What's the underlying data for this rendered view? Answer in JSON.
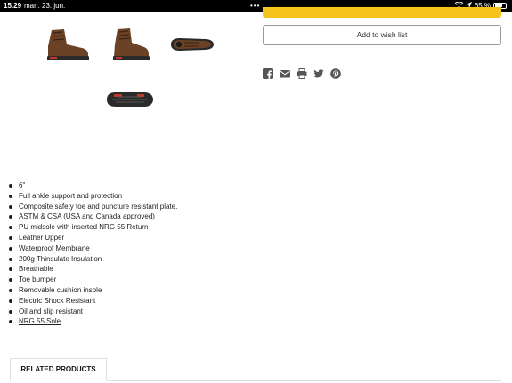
{
  "status_bar": {
    "time": "15.29",
    "date": "man. 23. jun.",
    "dots": "•••",
    "battery": "65 %"
  },
  "product": {
    "wishlist_label": "Add to wish list",
    "gallery": [
      {
        "icon": "boot-side-view-icon"
      },
      {
        "icon": "boot-angled-view-icon"
      },
      {
        "icon": "boot-top-view-icon"
      },
      {
        "icon": "boot-sole-view-icon"
      }
    ],
    "share_icons": [
      "facebook-icon",
      "email-icon",
      "print-icon",
      "twitter-icon",
      "pinterest-icon"
    ],
    "features": [
      "6\"",
      "Full ankle support and protection",
      "Composite safety toe and puncture resistant plate.",
      "ASTM & CSA (USA and Canada approved)",
      "PU midsole with inserted NRG 55 Return",
      "Leather Upper",
      "Waterproof Membrane",
      "200g Thinsulate Insulation",
      "Breathable",
      "Toe bumper",
      "Removable cushion insole",
      "Electric Shock Resistant",
      "Oil and slip resistant",
      "NRG 55 Sole"
    ]
  },
  "tabs": {
    "related_products": "RELATED PRODUCTS"
  },
  "colors": {
    "cart_button": "#f6c31c",
    "boot_leather": "#6b4226",
    "sole": "#2a2a2a",
    "sole_accent": "#c0392b"
  }
}
